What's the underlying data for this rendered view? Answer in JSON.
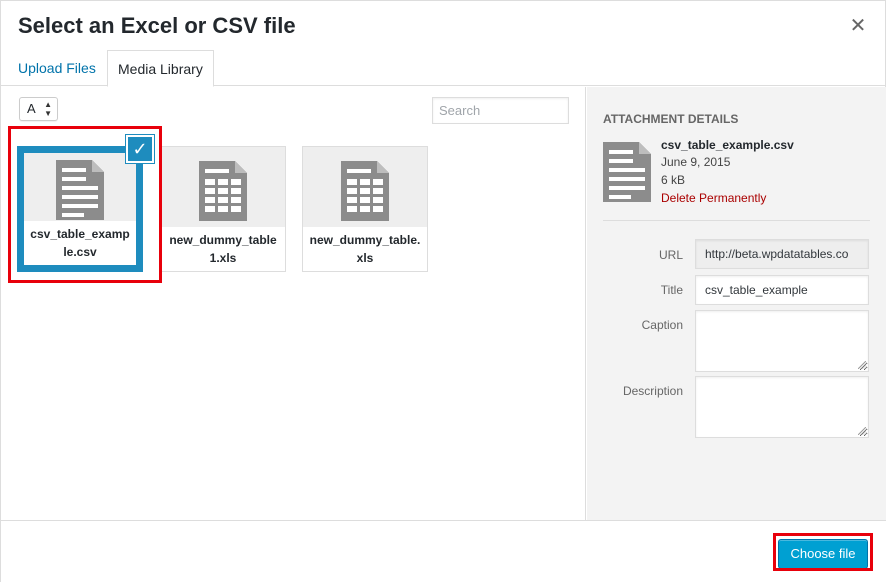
{
  "modal": {
    "title": "Select an Excel or CSV file",
    "close_icon": "close-icon"
  },
  "tabs": [
    {
      "label": "Upload Files",
      "active": false
    },
    {
      "label": "Media Library",
      "active": true
    }
  ],
  "toolbar_top": {
    "sort_value": "A",
    "search_placeholder": "Search"
  },
  "attachments": [
    {
      "filename": "csv_table_example.csv",
      "selected": true,
      "icon": "document-icon"
    },
    {
      "filename": "new_dummy_table1.xls",
      "selected": false,
      "icon": "spreadsheet-icon"
    },
    {
      "filename": "new_dummy_table.xls",
      "selected": false,
      "icon": "spreadsheet-icon"
    }
  ],
  "details": {
    "heading": "Attachment Details",
    "filename": "csv_table_example.csv",
    "date": "June 9, 2015",
    "size": "6 kB",
    "delete_label": "Delete Permanently",
    "fields": {
      "url_label": "URL",
      "url_value": "http://beta.wpdatatables.co",
      "title_label": "Title",
      "title_value": "csv_table_example",
      "caption_label": "Caption",
      "caption_value": "",
      "description_label": "Description",
      "description_value": ""
    }
  },
  "footer": {
    "choose_label": "Choose file"
  },
  "colors": {
    "accent": "#0073aa",
    "primary_button": "#00a0d2",
    "selection": "#1e8cbe",
    "highlight": "#e8000b",
    "delete": "#aa0000"
  }
}
